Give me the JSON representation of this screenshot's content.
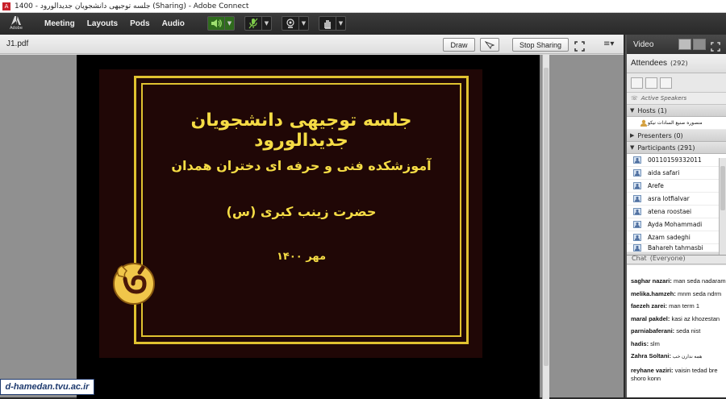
{
  "window": {
    "title": "جلسه توجیهی دانشجویان جدیدالورود - 1400 (Sharing) - Adobe Connect",
    "icon": "adobe-connect-icon"
  },
  "menubar": {
    "logo_text": "Adobe",
    "items": [
      "Meeting",
      "Layouts",
      "Pods",
      "Audio"
    ],
    "buttons": [
      {
        "name": "speaker-icon",
        "state": "on"
      },
      {
        "name": "microphone-icon",
        "state": "muted"
      },
      {
        "name": "webcam-icon",
        "state": "off"
      },
      {
        "name": "raise-hand-icon",
        "state": "off"
      }
    ]
  },
  "share_pod": {
    "title": "J1.pdf",
    "draw_label": "Draw",
    "stop_sharing_label": "Stop Sharing",
    "slide": {
      "line1": "جلسه توجیهی دانشجویان جدیدالورود",
      "line2": "آموزشکده فنی و حرفه ای دختران همدان",
      "line3": "حضرت زینب کبری (س)",
      "line4": "مهر ۱۴۰۰",
      "colors": {
        "background": "#200706",
        "frame": "#e0c230",
        "text": "#f5dc45"
      }
    }
  },
  "watermark": "d-hamedan.tvu.ac.ir",
  "video_pod": {
    "title": "Video"
  },
  "attendees_pod": {
    "title": "Attendees",
    "count": "(292)",
    "active_speakers": "Active Speakers",
    "hosts_label": "Hosts (1)",
    "hosts": [
      "منصوره صنیع السادات نیکو"
    ],
    "presenters_label": "Presenters (0)",
    "participants_label": "Participants (291)",
    "participants": [
      "00110159332011",
      "aida safari",
      "Arefe",
      "asra lotfialvar",
      "atena roostaei",
      "Ayda Mohammadi",
      "Azam sadeghi",
      "Bahareh tahmasbi"
    ]
  },
  "chat_pod": {
    "title": "Chat",
    "scope": "(Everyone)",
    "messages": [
      {
        "user": "saghar nazari:",
        "text": " man seda nadaram"
      },
      {
        "user": "melika.hamzeh:",
        "text": " mnm seda ndrm"
      },
      {
        "user": "faezeh zarei:",
        "text": " man term 1"
      },
      {
        "user": "maral pakdel:",
        "text": " kasi az khozestan"
      },
      {
        "user": "parniabaferani:",
        "text": "  seda nist"
      },
      {
        "user": "hadis:",
        "text": " slm"
      },
      {
        "user": "Zahra Soltani:",
        "text": " همه ندارن خب"
      },
      {
        "user": "reyhane vaziri:",
        "text": " vaisin tedad bre shoro konn"
      }
    ]
  }
}
